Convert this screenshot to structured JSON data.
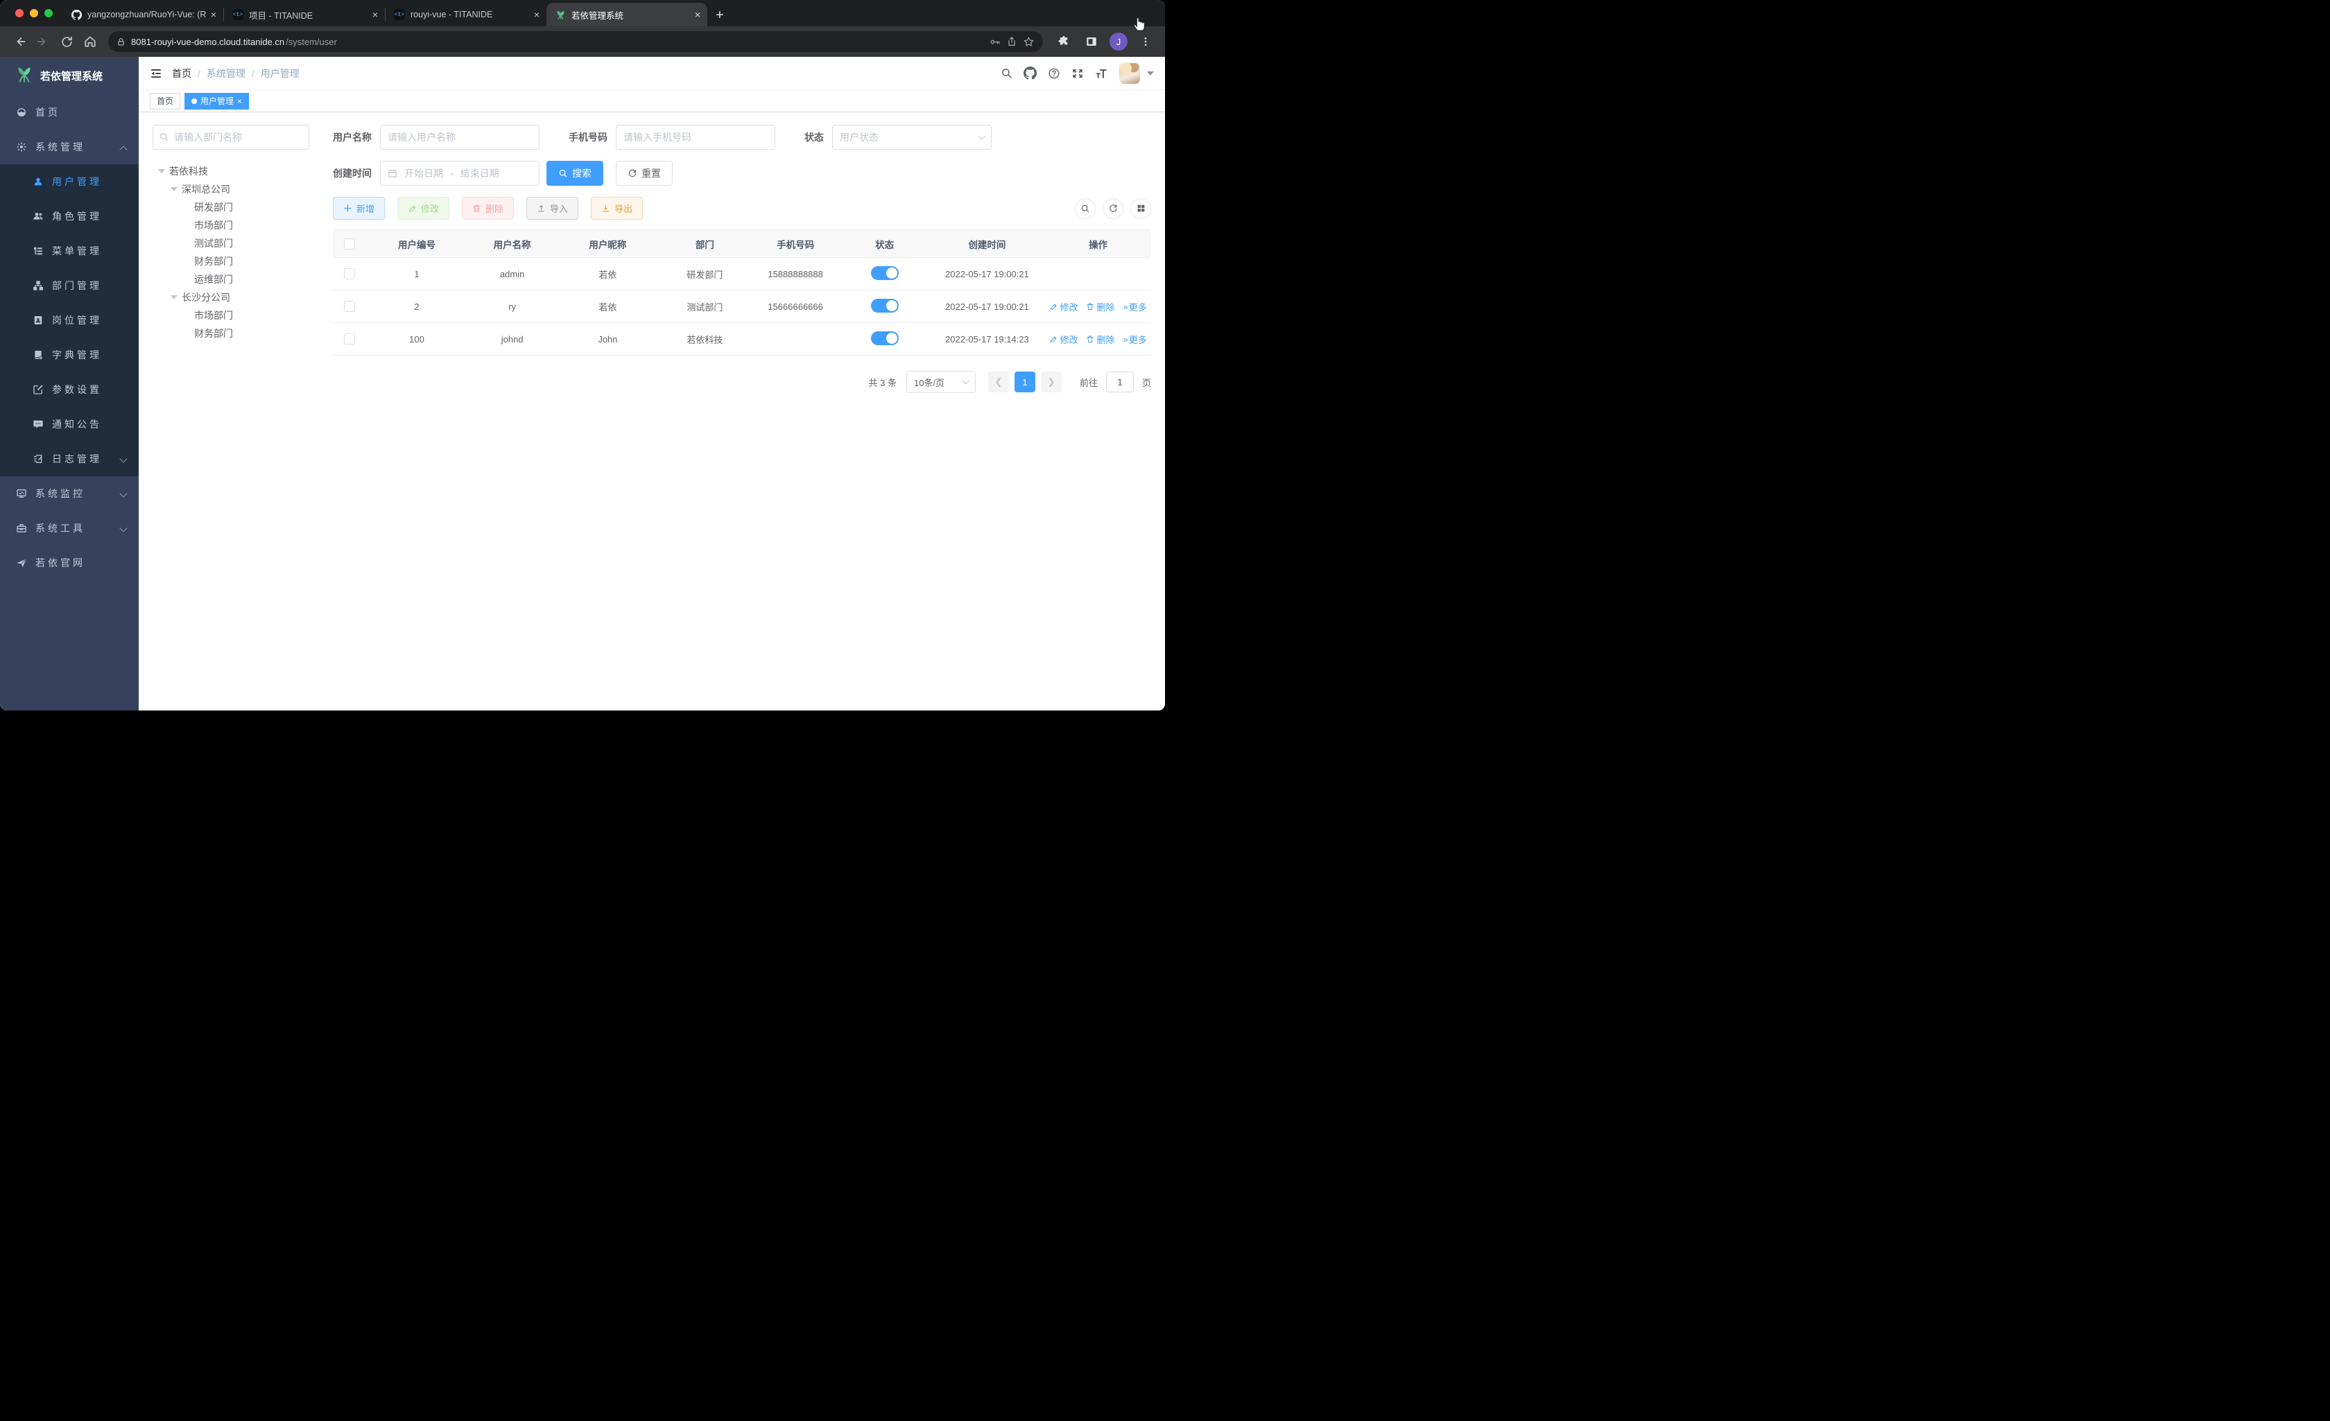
{
  "colors": {
    "accent": "#409eff",
    "sidebar_bg": "#36425c",
    "submenu_bg": "#1f2d3d",
    "tag_active": "#409eff",
    "success": "#67c23a",
    "danger": "#f56c6c",
    "warning": "#e6a23c",
    "chrome_dark": "#1e1f21"
  },
  "browser": {
    "tabs": [
      "yangzongzhuan/RuoYi-Vue: (R",
      "项目 - TITANIDE",
      "rouyi-vue - TITANIDE",
      "若依管理系统"
    ],
    "new_tab": "+",
    "url_host": "8081-rouyi-vue-demo.cloud.titanide.cn",
    "url_path": "/system/user",
    "profile_initial": "J"
  },
  "sidebar": {
    "title": "若依管理系统",
    "items": [
      "首页",
      "系统管理",
      "用户管理",
      "角色管理",
      "菜单管理",
      "部门管理",
      "岗位管理",
      "字典管理",
      "参数设置",
      "通知公告",
      "日志管理",
      "系统监控",
      "系统工具",
      "若依官网"
    ]
  },
  "header": {
    "breadcrumb": [
      "首页",
      "系统管理",
      "用户管理"
    ],
    "separator": "/"
  },
  "tags": {
    "home": "首页",
    "current": "用户管理"
  },
  "filters": {
    "dept_placeholder": "请输入部门名称",
    "username_label": "用户名称",
    "username_placeholder": "请输入用户名称",
    "phone_label": "手机号码",
    "phone_placeholder": "请输入手机号码",
    "status_label": "状态",
    "status_placeholder": "用户状态",
    "date_label": "创建时间",
    "date_start": "开始日期",
    "date_separator": "-",
    "date_end": "结束日期",
    "search": "搜索",
    "reset": "重置"
  },
  "tree": {
    "nodes": [
      "若依科技",
      "深圳总公司",
      "研发部门",
      "市场部门",
      "测试部门",
      "财务部门",
      "运维部门",
      "长沙分公司",
      "市场部门",
      "财务部门"
    ]
  },
  "toolbar": {
    "add": "新增",
    "edit": "修改",
    "delete": "删除",
    "import": "导入",
    "export": "导出"
  },
  "table": {
    "columns": [
      "用户编号",
      "用户名称",
      "用户昵称",
      "部门",
      "手机号码",
      "状态",
      "创建时间",
      "操作"
    ],
    "action_labels": {
      "edit": "修改",
      "delete": "删除",
      "more": "更多"
    },
    "rows": [
      {
        "id": "1",
        "username": "admin",
        "nickname": "若依",
        "dept": "研发部门",
        "phone": "15888888888",
        "status": "on",
        "created": "2022-05-17 19:00:21"
      },
      {
        "id": "2",
        "username": "ry",
        "nickname": "若依",
        "dept": "测试部门",
        "phone": "15666666666",
        "status": "on",
        "created": "2022-05-17 19:00:21"
      },
      {
        "id": "100",
        "username": "johnd",
        "nickname": "John",
        "dept": "若依科技",
        "phone": "",
        "status": "on",
        "created": "2022-05-17 19:14:23"
      }
    ]
  },
  "pagination": {
    "total": "共 3 条",
    "page_size": "10条/页",
    "current": "1",
    "goto_label": "前往",
    "goto_value": "1",
    "unit": "页"
  }
}
